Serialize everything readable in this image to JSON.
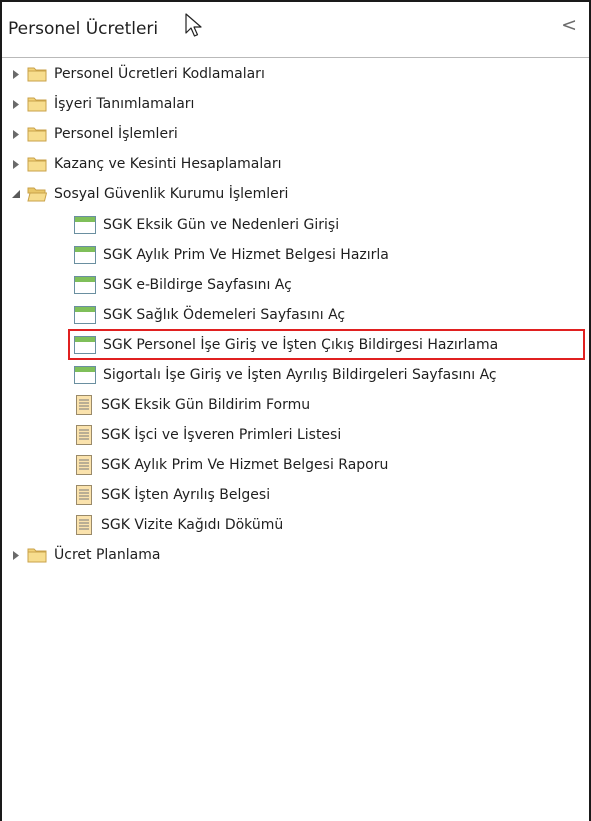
{
  "panel": {
    "title": "Personel Ücretleri",
    "collapse_glyph": "<"
  },
  "tree": {
    "groups": [
      {
        "label": "Personel Ücretleri Kodlamaları",
        "expanded": false,
        "icon": "folder-icon"
      },
      {
        "label": "İşyeri Tanımlamaları",
        "expanded": false,
        "icon": "folder-icon"
      },
      {
        "label": "Personel İşlemleri",
        "expanded": false,
        "icon": "folder-icon"
      },
      {
        "label": "Kazanç ve Kesinti Hesaplamaları",
        "expanded": false,
        "icon": "folder-icon"
      },
      {
        "label": "Sosyal Güvenlik Kurumu İşlemleri",
        "expanded": true,
        "icon": "folder-open-icon"
      },
      {
        "label": "Ücret Planlama",
        "expanded": false,
        "icon": "folder-icon"
      }
    ],
    "sgk_items": [
      {
        "label": "SGK Eksik Gün ve Nedenleri Girişi",
        "icon": "form-icon"
      },
      {
        "label": "SGK Aylık Prim Ve Hizmet Belgesi Hazırla",
        "icon": "form-icon"
      },
      {
        "label": "SGK e-Bildirge Sayfasını Aç",
        "icon": "form-icon"
      },
      {
        "label": "SGK Sağlık Ödemeleri Sayfasını Aç",
        "icon": "form-icon"
      },
      {
        "label": "SGK Personel İşe Giriş ve İşten Çıkış Bildirgesi Hazırlama",
        "icon": "form-icon",
        "highlighted": true
      },
      {
        "label": "Sigortalı İşe Giriş ve İşten Ayrılış Bildirgeleri Sayfasını Aç",
        "icon": "form-icon"
      },
      {
        "label": "SGK Eksik Gün Bildirim Formu",
        "icon": "report-icon"
      },
      {
        "label": "SGK İşci ve İşveren Primleri Listesi",
        "icon": "report-icon"
      },
      {
        "label": "SGK Aylık Prim Ve Hizmet Belgesi Raporu",
        "icon": "report-icon"
      },
      {
        "label": "SGK İşten Ayrılış Belgesi",
        "icon": "report-icon"
      },
      {
        "label": "SGK Vizite Kağıdı Dökümü",
        "icon": "report-icon"
      }
    ]
  },
  "colors": {
    "highlight_border": "#e02020",
    "folder_fill": "#f2d37a",
    "form_header": "#7fbf5a",
    "report_fill": "#f4c97a"
  }
}
